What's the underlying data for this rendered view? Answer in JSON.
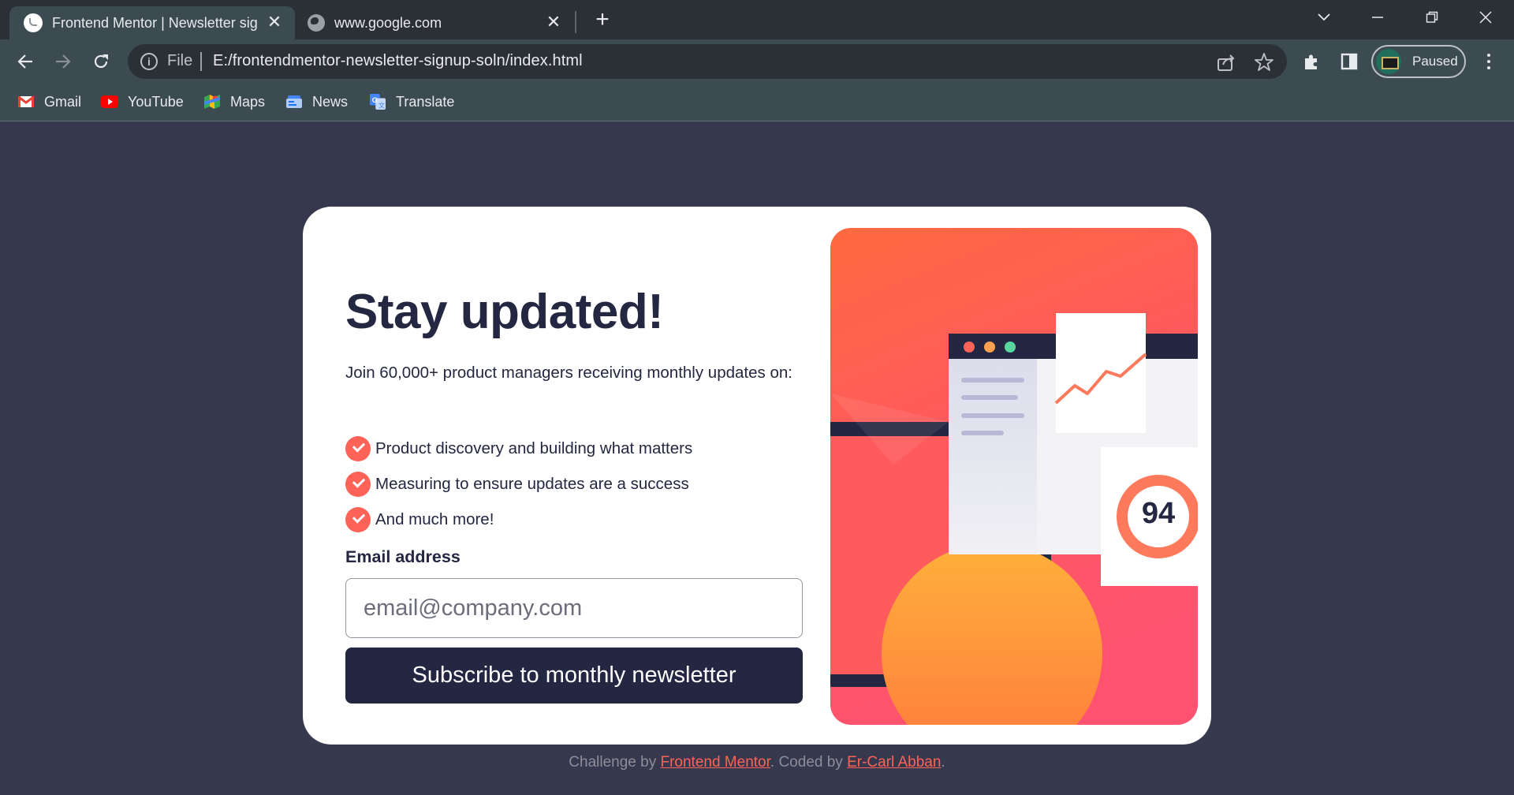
{
  "browser": {
    "tabs": [
      {
        "title": "Frontend Mentor | Newsletter sig",
        "active": true
      },
      {
        "title": "www.google.com",
        "active": false
      }
    ],
    "address": {
      "scheme_label": "File",
      "url": "E:/frontendmentor-newsletter-signup-soln/index.html"
    },
    "profile_label": "Paused",
    "bookmarks": [
      "Gmail",
      "YouTube",
      "Maps",
      "News",
      "Translate"
    ]
  },
  "page": {
    "title": "Stay updated!",
    "intro": "Join 60,000+ product managers receiving monthly updates on:",
    "features": [
      "Product discovery and building what matters",
      "Measuring to ensure updates are a success",
      "And much more!"
    ],
    "email_label": "Email address",
    "email_placeholder": "email@company.com",
    "subscribe_label": "Subscribe to monthly newsletter",
    "illustration": {
      "score": "94"
    },
    "colors": {
      "accent": "#ff6257",
      "dark": "#242742",
      "background": "#36384d"
    }
  },
  "footer": {
    "prefix": "Challenge by ",
    "link1": "Frontend Mentor",
    "middle": ". Coded by ",
    "link2": "Er-Carl Abban",
    "suffix": "."
  }
}
